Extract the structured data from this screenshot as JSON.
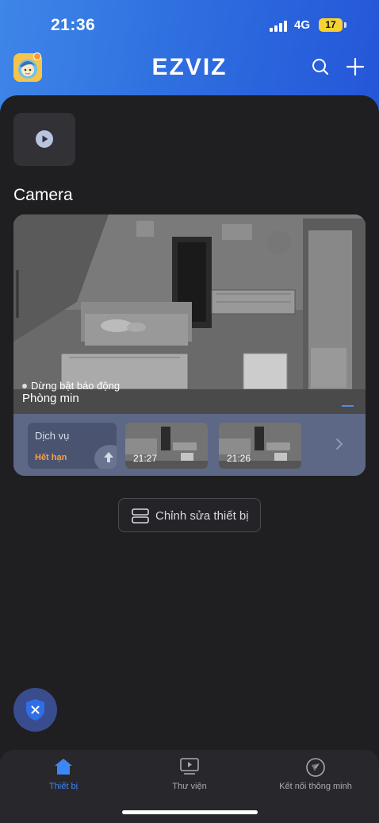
{
  "status_bar": {
    "time": "21:36",
    "network": "4G",
    "battery": "17"
  },
  "header": {
    "logo_text": "EZVIZ",
    "icons": [
      "avatar-icon",
      "search-icon",
      "plus-icon"
    ]
  },
  "quick_action": {
    "icon": "play-icon"
  },
  "section": {
    "title": "Camera"
  },
  "camera": {
    "status": "Dừng bật báo động",
    "name": "Phòng min",
    "service": {
      "label": "Dịch vụ",
      "expire": "Hết hạn"
    },
    "thumbnails": [
      {
        "time": "21:27"
      },
      {
        "time": "21:26"
      }
    ]
  },
  "edit_button": {
    "label": "Chỉnh sửa thiết bị"
  },
  "tabs": [
    {
      "label": "Thiết bị",
      "icon": "home-icon",
      "active": true
    },
    {
      "label": "Thư viện",
      "icon": "library-icon",
      "active": false
    },
    {
      "label": "Kết nối thông minh",
      "icon": "navigation-icon",
      "active": false
    }
  ],
  "colors": {
    "accent": "#3d86f5",
    "header_gradient_start": "#3f86e8",
    "header_gradient_end": "#2456d8",
    "expire": "#f5a04a",
    "background": "#1f1f21"
  }
}
